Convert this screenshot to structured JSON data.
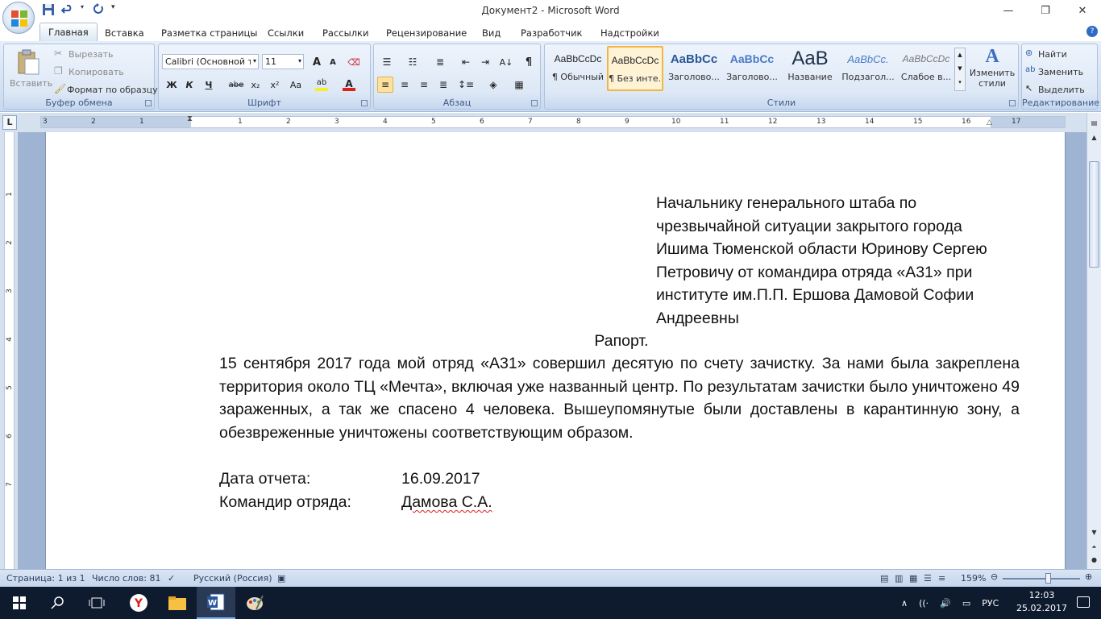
{
  "window": {
    "title": "Документ2 - Microsoft Word",
    "minimize": "—",
    "maximize": "❐",
    "close": "✕"
  },
  "tabs": [
    "Главная",
    "Вставка",
    "Разметка страницы",
    "Ссылки",
    "Рассылки",
    "Рецензирование",
    "Вид",
    "Разработчик",
    "Надстройки"
  ],
  "ribbon": {
    "clipboard": {
      "label": "Буфер обмена",
      "paste": "Вставить",
      "cut": "Вырезать",
      "copy": "Копировать",
      "format_painter": "Формат по образцу"
    },
    "font": {
      "label": "Шрифт",
      "font_name": "Calibri (Основной те",
      "font_size": "11",
      "bold": "Ж",
      "italic": "К",
      "underline": "Ч",
      "strike": "abe",
      "subscript": "x₂",
      "superscript": "x²",
      "change_case": "Aa",
      "grow": "A",
      "shrink": "A"
    },
    "paragraph": {
      "label": "Абзац"
    },
    "styles": {
      "label": "Стили",
      "items": [
        {
          "sample": "AaBbCcDc",
          "name": "¶ Обычный"
        },
        {
          "sample": "AaBbCcDc",
          "name": "¶ Без инте..."
        },
        {
          "sample": "AaBbCc",
          "name": "Заголово..."
        },
        {
          "sample": "AaBbCc",
          "name": "Заголово..."
        },
        {
          "sample": "AaB",
          "name": "Название"
        },
        {
          "sample": "AaBbCc.",
          "name": "Подзагол..."
        },
        {
          "sample": "AaBbCcDc",
          "name": "Слабое в..."
        }
      ],
      "change_styles": "Изменить стили"
    },
    "editing": {
      "label": "Редактирование",
      "find": "Найти",
      "replace": "Заменить",
      "select": "Выделить"
    }
  },
  "ruler": {
    "corner": "L",
    "numbers": [
      "3",
      "2",
      "1",
      "1",
      "2",
      "3",
      "4",
      "5",
      "6",
      "7",
      "8",
      "9",
      "10",
      "11",
      "12",
      "13",
      "14",
      "15",
      "16",
      "17"
    ]
  },
  "vruler": {
    "numbers": [
      "1",
      "2",
      "3",
      "4",
      "5",
      "6",
      "7"
    ]
  },
  "document": {
    "addressee": [
      "Начальнику генерального штаба по",
      "чрезвычайной ситуации закрытого города",
      "Ишима Тюменской области Юринову Сергею",
      "Петровичу от командира отряда «А31» при",
      "институте им.П.П. Ершова Дамовой Софии",
      "Андреевны"
    ],
    "heading": "Рапорт.",
    "body": "15 сентября 2017 года мой отряд «А31» совершил десятую по счету зачистку. За нами была закреплена территория около ТЦ «Мечта», включая уже названный центр. По результатам зачистки было уничтожено 49 зараженных, а так же спасено 4 человека. Вышеупомянутые были доставлены в карантинную зону, а обезвреженные уничтожены соответствующим образом.",
    "date_label": "Дата отчета:",
    "date_value": "16.09.2017",
    "commander_label": "Командир отряда:",
    "commander_value": "Дамова С.А."
  },
  "statusbar": {
    "page": "Страница: 1 из 1",
    "words": "Число слов: 81",
    "language": "Русский (Россия)",
    "zoom": "159%",
    "zoom_fraction": 0.59
  },
  "taskbar": {
    "language": "РУС",
    "time": "12:03",
    "date": "25.02.2017"
  }
}
